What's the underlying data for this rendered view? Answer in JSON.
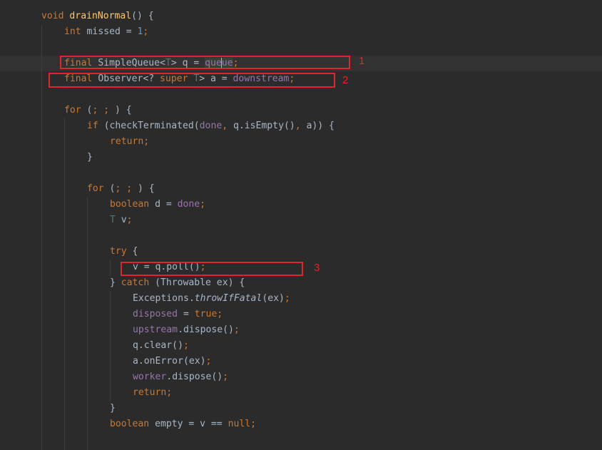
{
  "code": {
    "lines": [
      [
        {
          "t": "void ",
          "c": "k"
        },
        {
          "t": "drainNormal",
          "c": "f"
        },
        {
          "t": "() {",
          "c": "p"
        }
      ],
      [
        {
          "t": "int ",
          "c": "k"
        },
        {
          "t": "missed = ",
          "c": "p"
        },
        {
          "t": "1",
          "c": "n"
        },
        {
          "t": ";",
          "c": "sm"
        }
      ],
      [],
      [
        {
          "t": "final ",
          "c": "k"
        },
        {
          "t": "SimpleQueue<",
          "c": "p"
        },
        {
          "t": "T",
          "c": "t"
        },
        {
          "t": "> q = ",
          "c": "p"
        },
        {
          "t": "que",
          "c": "fd hl-field"
        },
        {
          "caret": true
        },
        {
          "t": "ue",
          "c": "fd hl-field"
        },
        {
          "t": ";",
          "c": "sm"
        }
      ],
      [
        {
          "t": "final ",
          "c": "k"
        },
        {
          "t": "Observer<? ",
          "c": "p"
        },
        {
          "t": "super ",
          "c": "k"
        },
        {
          "t": "T",
          "c": "t"
        },
        {
          "t": "> a = ",
          "c": "p"
        },
        {
          "t": "downstream",
          "c": "fd"
        },
        {
          "t": ";",
          "c": "sm"
        }
      ],
      [],
      [
        {
          "t": "for ",
          "c": "k"
        },
        {
          "t": "(",
          "c": "p"
        },
        {
          "t": "; ; ",
          "c": "sm"
        },
        {
          "t": ") {",
          "c": "p"
        }
      ],
      [
        {
          "t": "if ",
          "c": "k"
        },
        {
          "t": "(checkTerminated(",
          "c": "p"
        },
        {
          "t": "done",
          "c": "fd"
        },
        {
          "t": ", ",
          "c": "sm"
        },
        {
          "t": "q.isEmpty()",
          "c": "p"
        },
        {
          "t": ", ",
          "c": "sm"
        },
        {
          "t": "a)) {",
          "c": "p"
        }
      ],
      [
        {
          "t": "return;",
          "c": "k"
        }
      ],
      [
        {
          "t": "}",
          "c": "p"
        }
      ],
      [],
      [
        {
          "t": "for ",
          "c": "k"
        },
        {
          "t": "(",
          "c": "p"
        },
        {
          "t": "; ; ",
          "c": "sm"
        },
        {
          "t": ") {",
          "c": "p"
        }
      ],
      [
        {
          "t": "boolean ",
          "c": "k"
        },
        {
          "t": "d = ",
          "c": "p"
        },
        {
          "t": "done",
          "c": "fd"
        },
        {
          "t": ";",
          "c": "sm"
        }
      ],
      [
        {
          "t": "T ",
          "c": "t"
        },
        {
          "t": "v",
          "c": "p"
        },
        {
          "t": ";",
          "c": "sm"
        }
      ],
      [],
      [
        {
          "t": "try ",
          "c": "k"
        },
        {
          "t": "{",
          "c": "p"
        }
      ],
      [
        {
          "t": "v = q.poll()",
          "c": "p"
        },
        {
          "t": ";",
          "c": "sm"
        }
      ],
      [
        {
          "t": "} ",
          "c": "p"
        },
        {
          "t": "catch ",
          "c": "k"
        },
        {
          "t": "(Throwable ex) {",
          "c": "p"
        }
      ],
      [
        {
          "t": "Exceptions.",
          "c": "p"
        },
        {
          "t": "throwIfFatal",
          "c": "it"
        },
        {
          "t": "(ex)",
          "c": "p"
        },
        {
          "t": ";",
          "c": "sm"
        }
      ],
      [
        {
          "t": "disposed",
          "c": "fd"
        },
        {
          "t": " = ",
          "c": "p"
        },
        {
          "t": "true",
          "c": "k"
        },
        {
          "t": ";",
          "c": "sm"
        }
      ],
      [
        {
          "t": "upstream",
          "c": "fd"
        },
        {
          "t": ".dispose()",
          "c": "p"
        },
        {
          "t": ";",
          "c": "sm"
        }
      ],
      [
        {
          "t": "q.clear()",
          "c": "p"
        },
        {
          "t": ";",
          "c": "sm"
        }
      ],
      [
        {
          "t": "a.onError(ex)",
          "c": "p"
        },
        {
          "t": ";",
          "c": "sm"
        }
      ],
      [
        {
          "t": "worker",
          "c": "fd"
        },
        {
          "t": ".dispose()",
          "c": "p"
        },
        {
          "t": ";",
          "c": "sm"
        }
      ],
      [
        {
          "t": "return;",
          "c": "k"
        }
      ],
      [
        {
          "t": "}",
          "c": "p"
        }
      ],
      [
        {
          "t": "boolean ",
          "c": "k"
        },
        {
          "t": "empty = v == ",
          "c": "p"
        },
        {
          "t": "null",
          "c": "k"
        },
        {
          "t": ";",
          "c": "sm"
        }
      ]
    ]
  },
  "annotations": {
    "box1_label": "1",
    "box2_label": "2",
    "box3_label": "3"
  },
  "colors": {
    "background": "#2b2b2b",
    "annotation": "#e0252b",
    "keyword": "#cc7832",
    "method": "#ffc66d",
    "number": "#6897bb",
    "field": "#9876aa",
    "type_param": "#507874",
    "text": "#a9b7c6"
  }
}
